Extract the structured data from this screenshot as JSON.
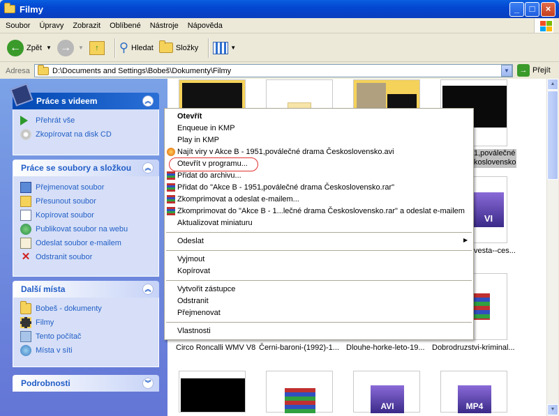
{
  "window": {
    "title": "Filmy"
  },
  "menubar": {
    "items": [
      "Soubor",
      "Úpravy",
      "Zobrazit",
      "Oblíbené",
      "Nástroje",
      "Nápověda"
    ]
  },
  "toolbar": {
    "back": "Zpět",
    "search": "Hledat",
    "folders": "Složky"
  },
  "address": {
    "label": "Adresa",
    "path": "D:\\Documents and Settings\\Bobeš\\Dokumenty\\Filmy",
    "go": "Přejít"
  },
  "tasks_video": {
    "title": "Práce s videem",
    "items": [
      "Přehrát vše",
      "Zkopírovat na disk CD"
    ]
  },
  "tasks_files": {
    "title": "Práce se soubory a složkou",
    "items": [
      "Přejmenovat soubor",
      "Přesunout soubor",
      "Kopírovat soubor",
      "Publikovat soubor na webu",
      "Odeslat soubor e-mailem",
      "Odstranit soubor"
    ]
  },
  "other_places": {
    "title": "Další místa",
    "items": [
      "Bobeš - dokumenty",
      "Filmy",
      "Tento počítač",
      "Místa v síti"
    ]
  },
  "details": {
    "title": "Podrobnosti"
  },
  "files": {
    "selected_line1": "1,poválečné",
    "selected_line2": "koslovensko",
    "right_row2": "vesta--ces...",
    "row3": [
      "Circo Roncalli WMV V8",
      "Černi-baroni-(1992)-1...",
      "Dlouhe-horke-leto-19...",
      "Dobrodruzstvi-kriminal..."
    ],
    "badges": {
      "avi": "AVI",
      "mp4": "MP4",
      "vi": "VI"
    }
  },
  "context_menu": {
    "open": "Otevřít",
    "enqueue": "Enqueue in KMP",
    "play": "Play in KMP",
    "scan": "Najít viry v Akce B - 1951,poválečné drama Československo.avi",
    "open_with": "Otevřít v programu...",
    "add_archive": "Přidat do archivu...",
    "add_to": "Přidat do \"Akce B - 1951,poválečné drama Československo.rar\"",
    "compress_email": "Zkomprimovat a odeslat e-mailem...",
    "compress_to_email": "Zkomprimovat do \"Akce B - 1...lečné drama Československo.rar\" a odeslat e-mailem",
    "update_thumb": "Aktualizovat miniaturu",
    "send_to": "Odeslat",
    "cut": "Vyjmout",
    "copy": "Kopírovat",
    "shortcut": "Vytvořit zástupce",
    "delete": "Odstranit",
    "rename": "Přejmenovat",
    "properties": "Vlastnosti"
  }
}
